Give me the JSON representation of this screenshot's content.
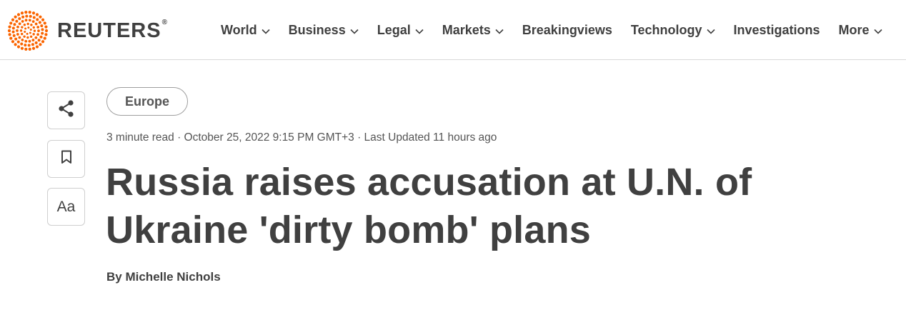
{
  "brand": {
    "name": "REUTERS",
    "registered_mark": "®",
    "logo_color": "#fa6400",
    "text_color": "#404040"
  },
  "nav": {
    "items": [
      {
        "label": "World",
        "has_dropdown": true
      },
      {
        "label": "Business",
        "has_dropdown": true
      },
      {
        "label": "Legal",
        "has_dropdown": true
      },
      {
        "label": "Markets",
        "has_dropdown": true
      },
      {
        "label": "Breakingviews",
        "has_dropdown": false
      },
      {
        "label": "Technology",
        "has_dropdown": true
      },
      {
        "label": "Investigations",
        "has_dropdown": false
      },
      {
        "label": "More",
        "has_dropdown": true
      }
    ]
  },
  "side_actions": {
    "share_icon": "share-icon",
    "bookmark_icon": "bookmark-icon",
    "font_size_label": "Aa"
  },
  "article": {
    "section_tag": "Europe",
    "meta": "3 minute read · October 25, 2022 9:15 PM GMT+3 · Last Updated 11 hours ago",
    "headline": "Russia raises accusation at U.N. of Ukraine 'dirty bomb' plans",
    "byline_prefix": "By ",
    "author": "Michelle Nichols"
  }
}
